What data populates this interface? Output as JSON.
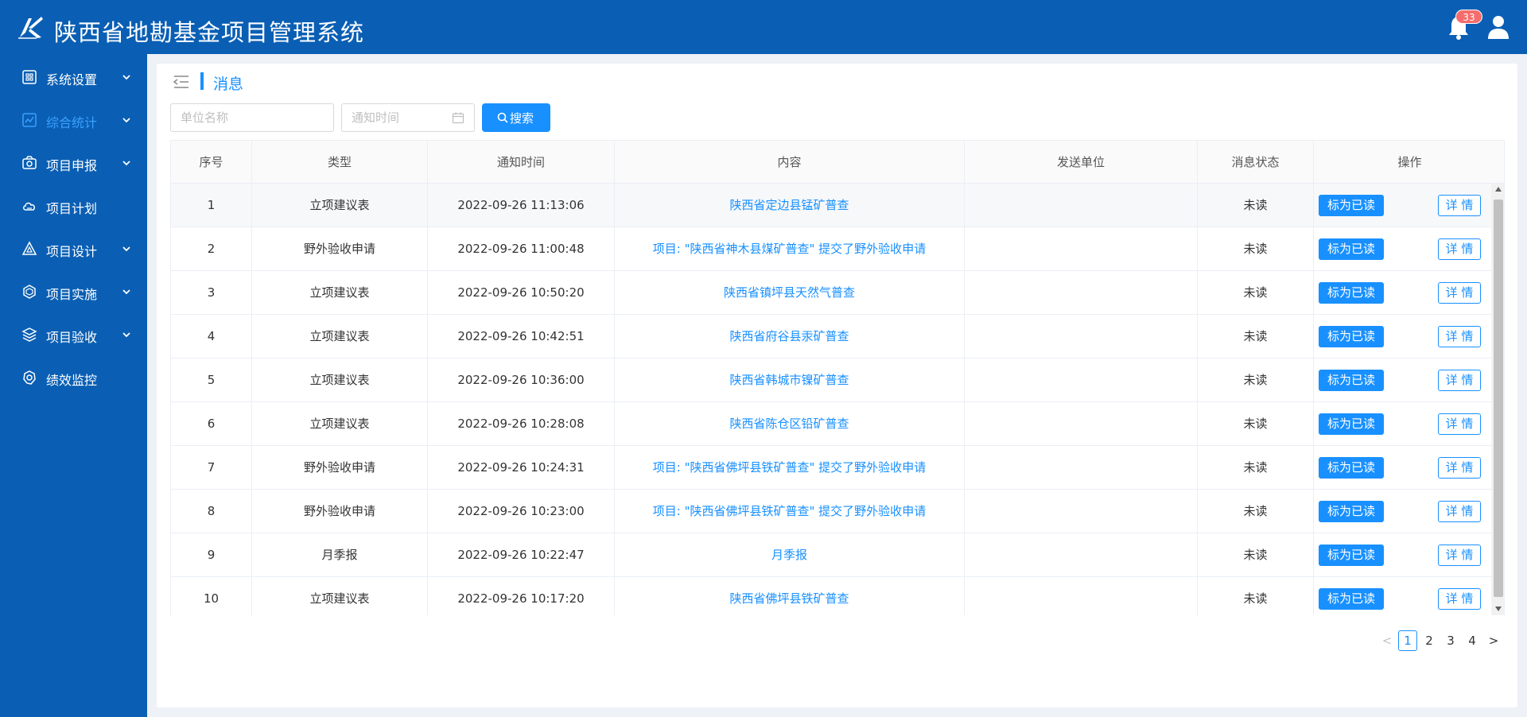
{
  "header": {
    "title": "陕西省地勘基金项目管理系统",
    "notification_count": "33",
    "logo_icon": "k-logo-icon",
    "bell_icon": "bell-icon",
    "user_icon": "user-icon",
    "bg_color": "#0a5fb4"
  },
  "sidebar": {
    "items": [
      {
        "label": "系统设置",
        "icon": "grid-settings-icon",
        "has_submenu": true,
        "active": false
      },
      {
        "label": "综合统计",
        "icon": "chart-line-icon",
        "has_submenu": true,
        "active": true
      },
      {
        "label": "项目申报",
        "icon": "camera-report-icon",
        "has_submenu": true,
        "active": false
      },
      {
        "label": "项目计划",
        "icon": "cloud-plan-icon",
        "has_submenu": false,
        "active": false
      },
      {
        "label": "项目设计",
        "icon": "triangle-design-icon",
        "has_submenu": true,
        "active": false
      },
      {
        "label": "项目实施",
        "icon": "hexagon-implement-icon",
        "has_submenu": true,
        "active": false
      },
      {
        "label": "项目验收",
        "icon": "layers-icon",
        "has_submenu": true,
        "active": false
      },
      {
        "label": "绩效监控",
        "icon": "gear-monitor-icon",
        "has_submenu": false,
        "active": false
      }
    ],
    "active_color": "#3aa0ff"
  },
  "page": {
    "title": "消息",
    "collapse_icon": "menu-collapse-icon"
  },
  "filters": {
    "unit_placeholder": "单位名称",
    "unit_value": "",
    "time_placeholder": "通知时间",
    "time_value": "",
    "calendar_icon": "calendar-icon",
    "search_label": "搜索",
    "search_icon": "search-icon"
  },
  "table": {
    "columns": [
      "序号",
      "类型",
      "通知时间",
      "内容",
      "发送单位",
      "消息状态",
      "操作"
    ],
    "rows": [
      {
        "index": "1",
        "type": "立项建议表",
        "time": "2022-09-26 11:13:06",
        "content": "陕西省定边县锰矿普查",
        "sender": "",
        "status": "未读"
      },
      {
        "index": "2",
        "type": "野外验收申请",
        "time": "2022-09-26 11:00:48",
        "content": "项目: \"陕西省神木县煤矿普查\" 提交了野外验收申请",
        "sender": "",
        "status": "未读"
      },
      {
        "index": "3",
        "type": "立项建议表",
        "time": "2022-09-26 10:50:20",
        "content": "陕西省镇坪县天然气普查",
        "sender": "",
        "status": "未读"
      },
      {
        "index": "4",
        "type": "立项建议表",
        "time": "2022-09-26 10:42:51",
        "content": "陕西省府谷县汞矿普查",
        "sender": "",
        "status": "未读"
      },
      {
        "index": "5",
        "type": "立项建议表",
        "time": "2022-09-26 10:36:00",
        "content": "陕西省韩城市镍矿普查",
        "sender": "",
        "status": "未读"
      },
      {
        "index": "6",
        "type": "立项建议表",
        "time": "2022-09-26 10:28:08",
        "content": "陕西省陈仓区铅矿普查",
        "sender": "",
        "status": "未读"
      },
      {
        "index": "7",
        "type": "野外验收申请",
        "time": "2022-09-26 10:24:31",
        "content": "项目: \"陕西省佛坪县铁矿普查\" 提交了野外验收申请",
        "sender": "",
        "status": "未读"
      },
      {
        "index": "8",
        "type": "野外验收申请",
        "time": "2022-09-26 10:23:00",
        "content": "项目: \"陕西省佛坪县铁矿普查\" 提交了野外验收申请",
        "sender": "",
        "status": "未读"
      },
      {
        "index": "9",
        "type": "月季报",
        "time": "2022-09-26 10:22:47",
        "content": "月季报",
        "sender": "",
        "status": "未读"
      },
      {
        "index": "10",
        "type": "立项建议表",
        "time": "2022-09-26 10:17:20",
        "content": "陕西省佛坪县铁矿普查",
        "sender": "",
        "status": "未读"
      }
    ],
    "mark_read_label": "标为已读",
    "detail_label": "详 情",
    "link_color": "#1890ff"
  },
  "pagination": {
    "pages": [
      "1",
      "2",
      "3",
      "4"
    ],
    "current": "1",
    "prev_icon": "chevron-left-icon",
    "next_icon": "chevron-right-icon",
    "prev_symbol": "<",
    "next_symbol": ">"
  }
}
